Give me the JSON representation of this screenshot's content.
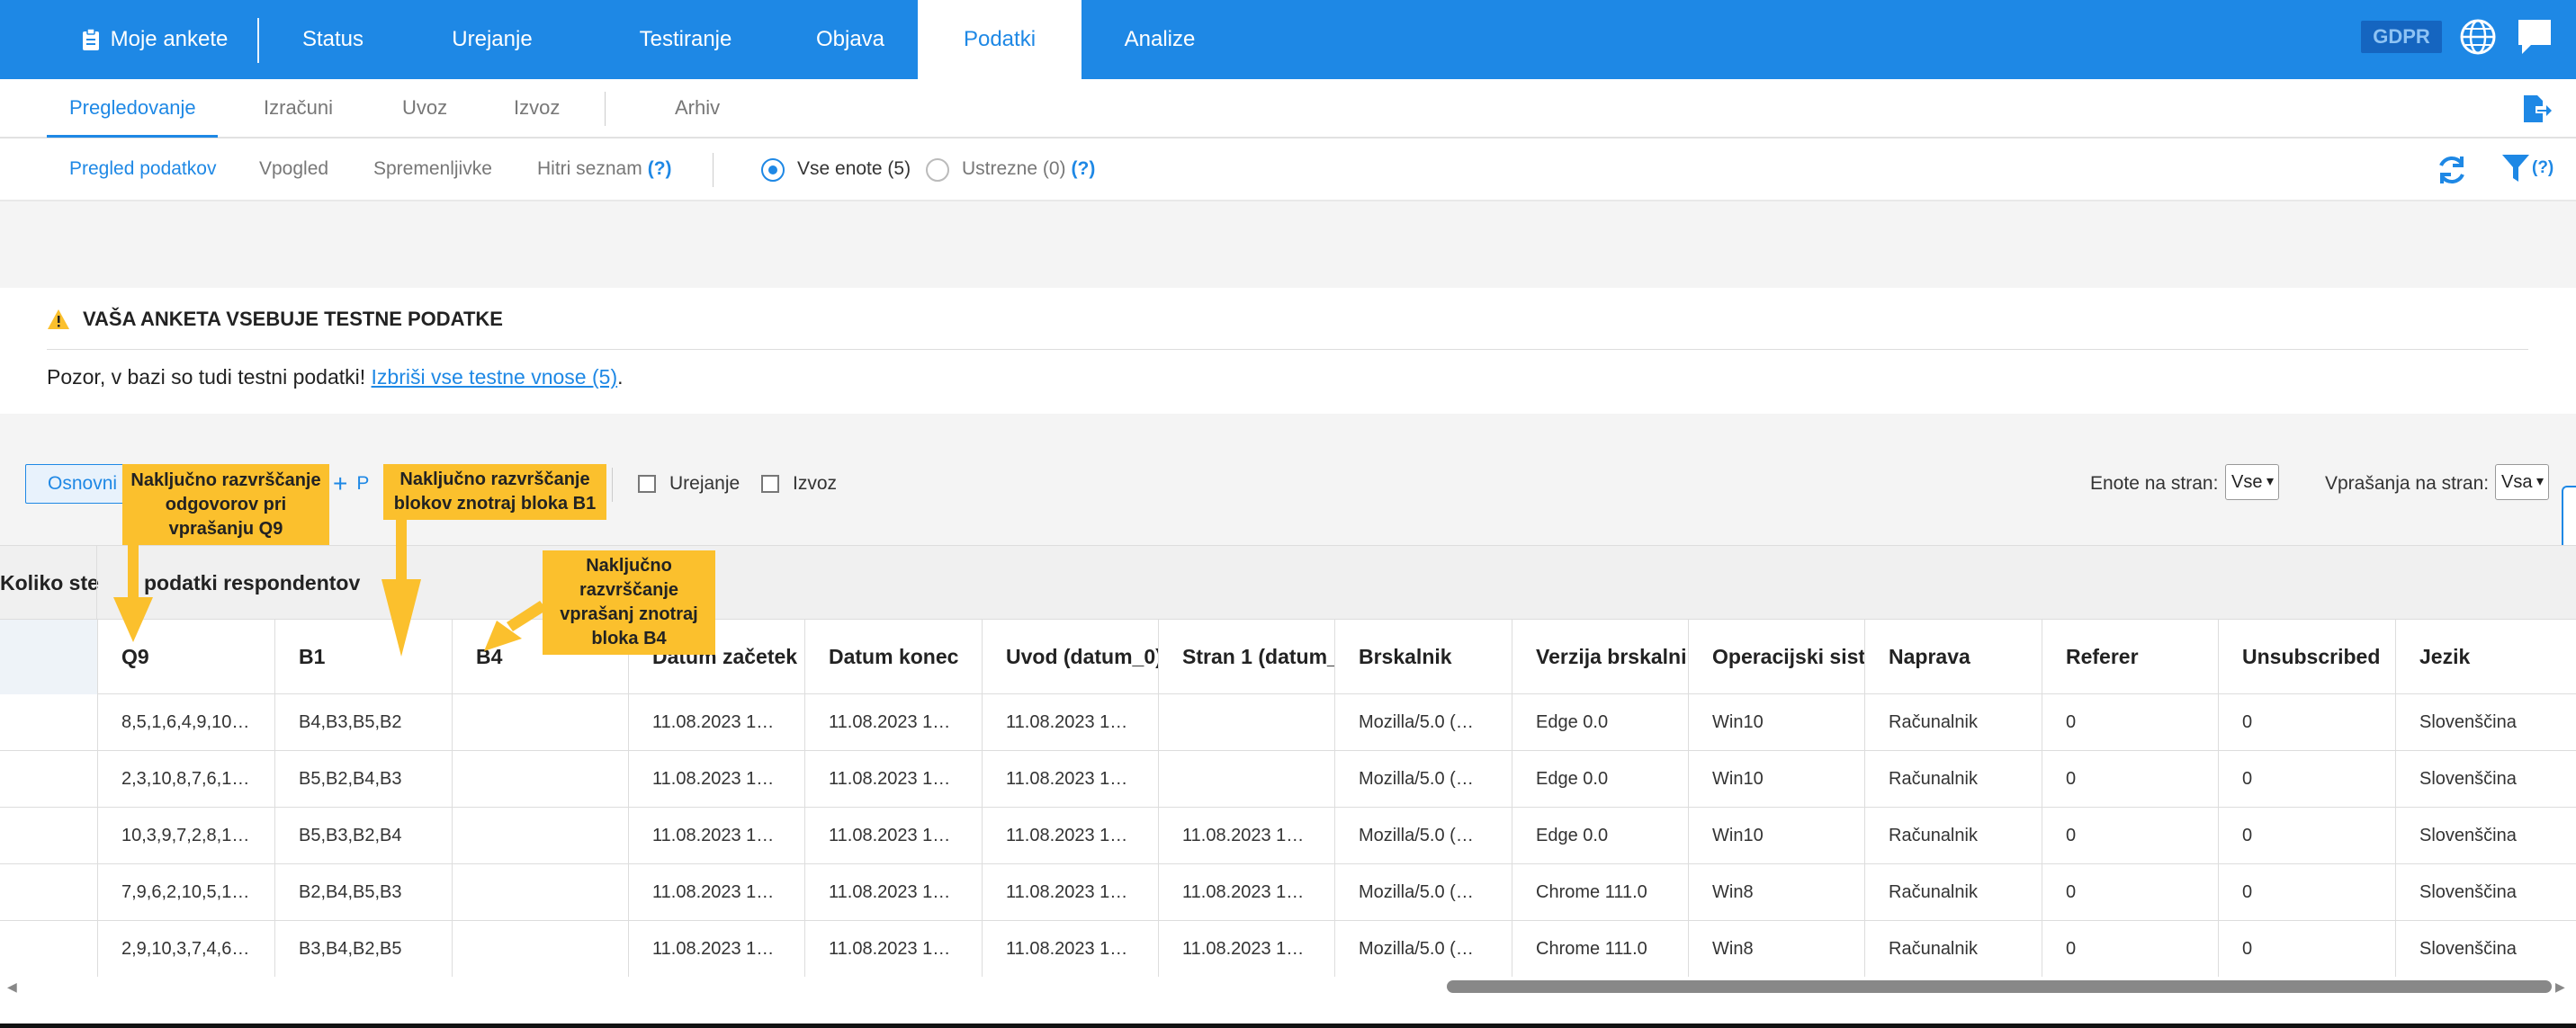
{
  "topnav": {
    "items": [
      {
        "label": "Moje ankete"
      },
      {
        "label": "Status"
      },
      {
        "label": "Urejanje"
      },
      {
        "label": "Testiranje"
      },
      {
        "label": "Objava"
      },
      {
        "label": "Podatki"
      },
      {
        "label": "Analize"
      }
    ],
    "active": "Podatki",
    "gdpr_label": "GDPR",
    "accent": "#1e88e5"
  },
  "nav2": {
    "items": [
      {
        "label": "Pregledovanje"
      },
      {
        "label": "Izračuni"
      },
      {
        "label": "Uvoz"
      },
      {
        "label": "Izvoz"
      },
      {
        "label": "Arhiv"
      }
    ],
    "active": "Pregledovanje"
  },
  "nav3": {
    "items": [
      {
        "label": "Pregled podatkov"
      },
      {
        "label": "Vpogled"
      },
      {
        "label": "Spremenljivke"
      },
      {
        "label": "Hitri seznam"
      }
    ],
    "help": "(?)",
    "radio_all": "Vse enote (5)",
    "radio_valid": "Ustrezne (0)",
    "filter_help": "(?)"
  },
  "warning": {
    "title": "VAŠA ANKETA VSEBUJE TESTNE PODATKE",
    "message": "Pozor, v bazi so tudi testni podatki!",
    "link": "Izbriši vse testne vnose (5)",
    "after": ".",
    "color": "#fbc02d"
  },
  "toolbar": {
    "basic_label": "Osnovni",
    "add_label": "P",
    "edit_label": "Urejanje",
    "export_label": "Izvoz",
    "units_label": "Enote na stran:",
    "units_value": "Vse",
    "questions_label": "Vprašanja na stran:",
    "questions_value": "Vsa"
  },
  "table": {
    "group_left": "Koliko ste",
    "group_right": "podatki respondentov",
    "columns": [
      "Q9",
      "B1",
      "B4",
      "Datum začetek",
      "Datum konec",
      "Uvod (datum_0)",
      "Stran 1 (datum_",
      "Brskalnik",
      "Verzija brskalnika",
      "Operacijski sistem",
      "Naprava",
      "Referer",
      "Unsubscribed",
      "Jezik"
    ],
    "rows": [
      [
        "8,5,1,6,4,9,10…",
        "B4,B3,B5,B2",
        "",
        "11.08.2023 1…",
        "11.08.2023 1…",
        "11.08.2023 1…",
        "",
        "Mozilla/5.0 (…",
        "Edge 0.0",
        "Win10",
        "Računalnik",
        "0",
        "0",
        "Slovenščina"
      ],
      [
        "2,3,10,8,7,6,1…",
        "B5,B2,B4,B3",
        "",
        "11.08.2023 1…",
        "11.08.2023 1…",
        "11.08.2023 1…",
        "",
        "Mozilla/5.0 (…",
        "Edge 0.0",
        "Win10",
        "Računalnik",
        "0",
        "0",
        "Slovenščina"
      ],
      [
        "10,3,9,7,2,8,1…",
        "B5,B3,B2,B4",
        "",
        "11.08.2023 1…",
        "11.08.2023 1…",
        "11.08.2023 1…",
        "11.08.2023 1…",
        "Mozilla/5.0 (…",
        "Edge 0.0",
        "Win10",
        "Računalnik",
        "0",
        "0",
        "Slovenščina"
      ],
      [
        "7,9,6,2,10,5,1…",
        "B2,B4,B5,B3",
        "",
        "11.08.2023 1…",
        "11.08.2023 1…",
        "11.08.2023 1…",
        "11.08.2023 1…",
        "Mozilla/5.0 (…",
        "Chrome 111.0",
        "Win8",
        "Računalnik",
        "0",
        "0",
        "Slovenščina"
      ],
      [
        "2,9,10,3,7,4,6…",
        "B3,B4,B2,B5",
        "",
        "11.08.2023 1…",
        "11.08.2023 1…",
        "11.08.2023 1…",
        "11.08.2023 1…",
        "Mozilla/5.0 (…",
        "Chrome 111.0",
        "Win8",
        "Računalnik",
        "0",
        "0",
        "Slovenščina"
      ]
    ]
  },
  "callouts": {
    "c1": "Naključno razvrščanje odgovorov pri vprašanju Q9",
    "c2": "Naključno razvrščanje blokov znotraj bloka B1",
    "c3": "Naključno razvrščanje vprašanj znotraj bloka B4",
    "color": "#fbc02d"
  }
}
